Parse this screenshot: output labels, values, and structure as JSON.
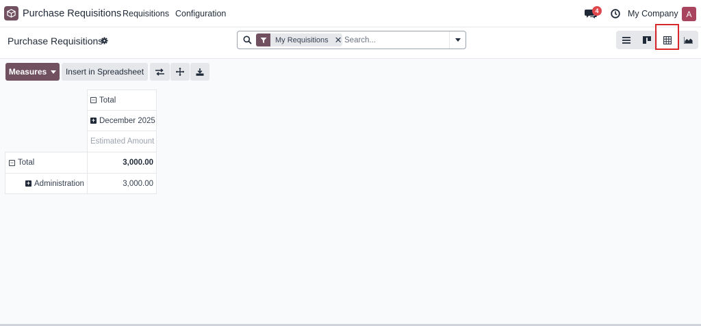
{
  "navbar": {
    "app_name": "Purchase Requisitions",
    "menu": [
      "Requisitions",
      "Configuration"
    ],
    "notification_count": "4",
    "company": "My Company",
    "avatar_initial": "A"
  },
  "control_panel": {
    "breadcrumb": "Purchase Requisitions",
    "search": {
      "facet_label": "My Requisitions",
      "placeholder": "Search..."
    },
    "views": [
      "list-view-icon",
      "kanban-view-icon",
      "pivot-view-icon",
      "graph-view-icon"
    ],
    "active_view": "pivot"
  },
  "toolbar": {
    "measures_label": "Measures",
    "spreadsheet_label": "Insert in Spreadsheet"
  },
  "pivot": {
    "col_header_total": "Total",
    "col_header_group": "December 2025",
    "measure_label": "Estimated Amount",
    "rows": [
      {
        "label": "Total",
        "value": "3,000.00"
      },
      {
        "label": "Administration",
        "value": "3,000.00"
      }
    ]
  },
  "colors": {
    "brand": "#71505f",
    "highlight": "#d9262b",
    "badge": "#e0474c",
    "avatar": "#a8445d"
  }
}
